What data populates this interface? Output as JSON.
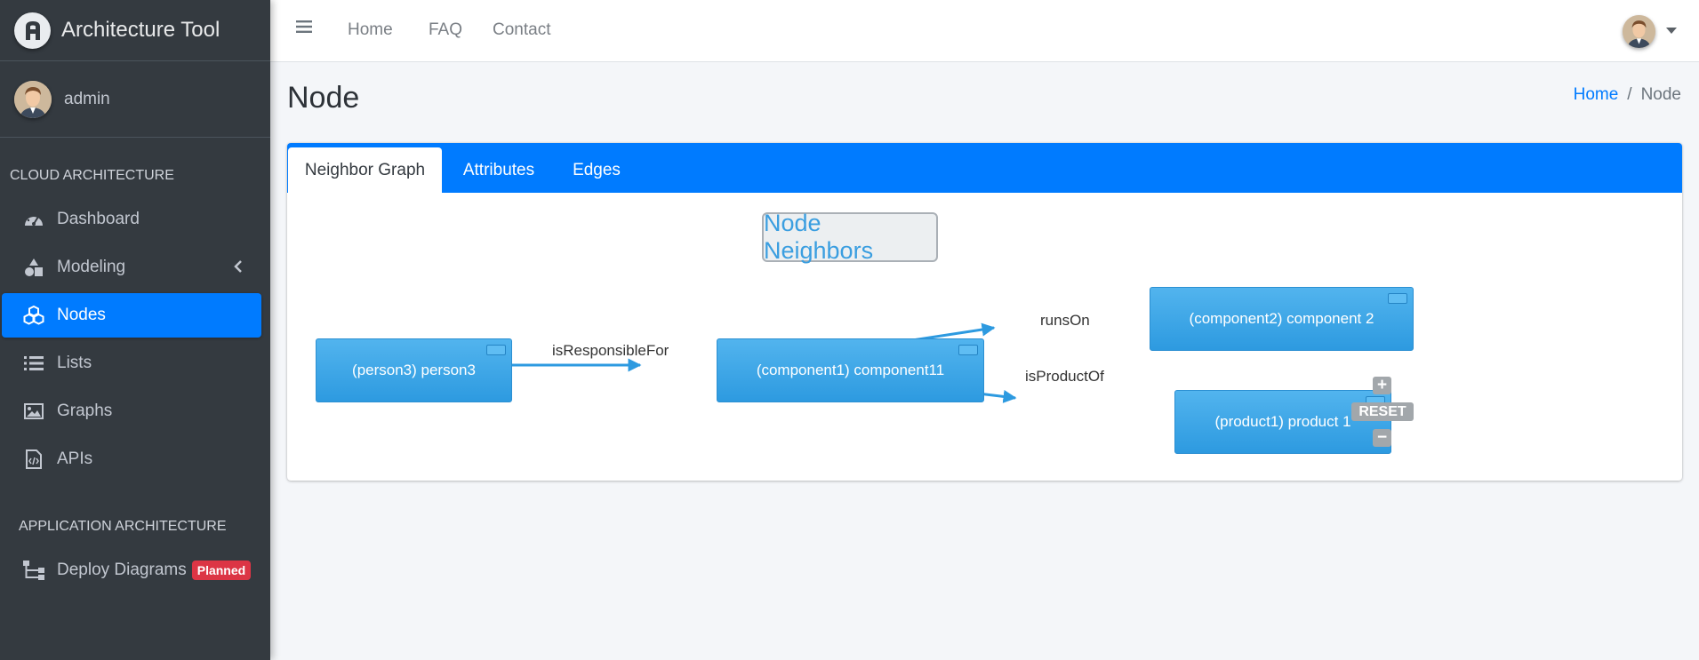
{
  "sidebar": {
    "brand": "Architecture Tool",
    "user": "admin",
    "section1": "CLOUD ARCHITECTURE",
    "items": [
      {
        "label": "Dashboard",
        "icon": "dashboard-icon"
      },
      {
        "label": "Modeling",
        "icon": "shapes-icon"
      },
      {
        "label": "Nodes",
        "icon": "cubes-icon",
        "active": true
      },
      {
        "label": "Lists",
        "icon": "list-icon"
      },
      {
        "label": "Graphs",
        "icon": "image-icon"
      },
      {
        "label": "APIs",
        "icon": "code-file-icon"
      }
    ],
    "section2": "APPLICATION ARCHITECTURE",
    "items2": [
      {
        "label": "Deploy Diagrams",
        "icon": "sitemap-icon",
        "badge": "Planned"
      }
    ]
  },
  "navbar": {
    "links": [
      "Home",
      "FAQ",
      "Contact"
    ]
  },
  "page": {
    "title": "Node",
    "breadcrumb": [
      "Home",
      "Node"
    ]
  },
  "tabs": [
    "Neighbor Graph",
    "Attributes",
    "Edges"
  ],
  "graph": {
    "title": "Node Neighbors",
    "nodes": [
      "(person3) person3",
      "(component1) component11",
      "(component2) component 2",
      "(product1) product 1"
    ],
    "edges": [
      "isResponsibleFor",
      "runsOn",
      "isProductOf"
    ],
    "controls": {
      "zoom_in": "+",
      "reset": "RESET",
      "zoom_out": "−"
    }
  },
  "colors": {
    "sidebar": "#343a40",
    "accent": "#007bff",
    "node": "#3aa5e8",
    "badge": "#dc3545"
  }
}
